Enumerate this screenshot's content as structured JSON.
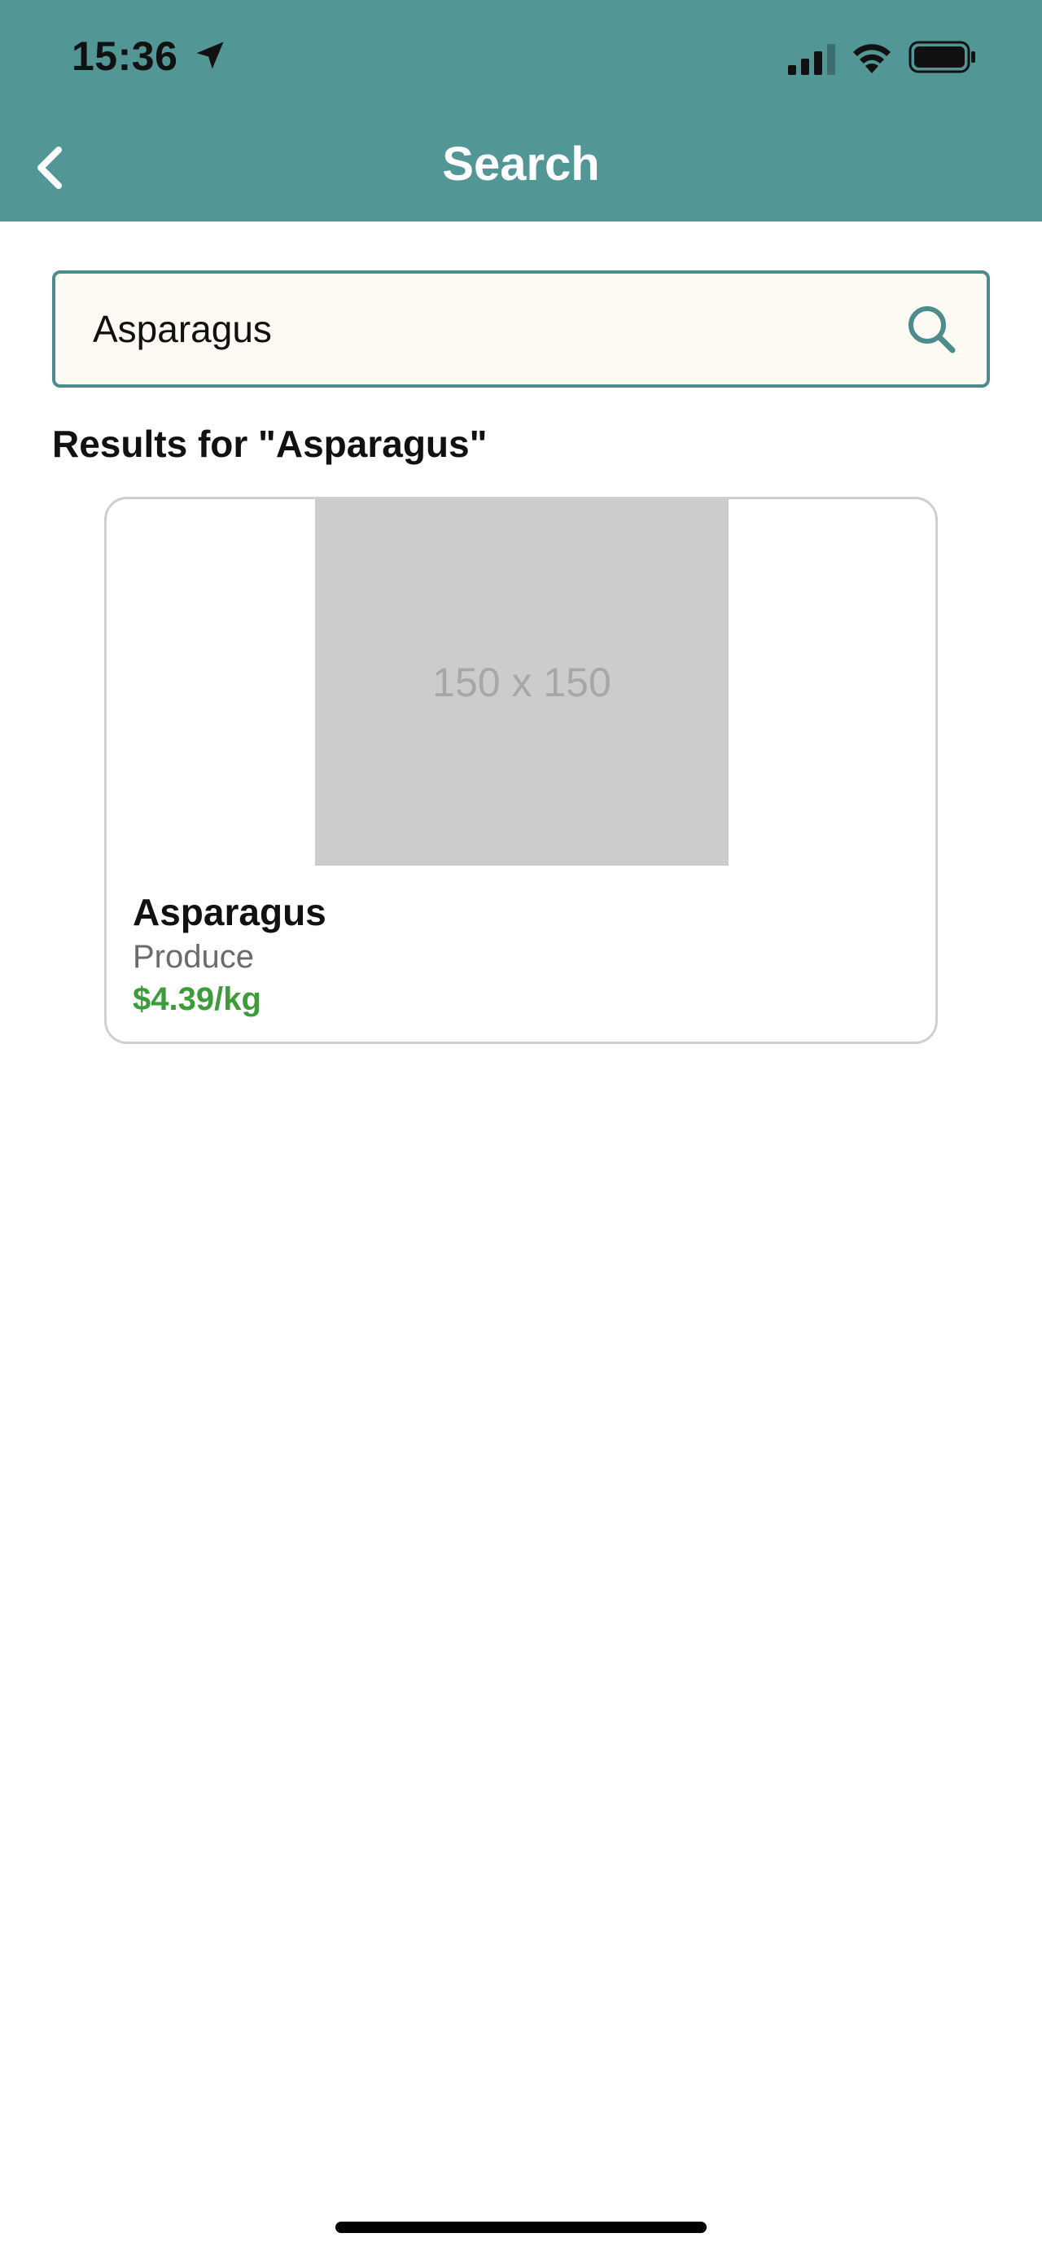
{
  "status_bar": {
    "time": "15:36",
    "icons": [
      "location-arrow-icon",
      "cellular-signal-icon",
      "wifi-icon",
      "battery-icon"
    ]
  },
  "nav": {
    "title": "Search",
    "back_icon": "chevron-left-icon"
  },
  "search": {
    "value": "Asparagus",
    "icon": "search-icon"
  },
  "results": {
    "heading": "Results for \"Asparagus\"",
    "items": [
      {
        "image_placeholder": "150 x 150",
        "name": "Asparagus",
        "category": "Produce",
        "price": "$4.39/kg"
      }
    ]
  },
  "colors": {
    "header_bg": "#529696",
    "accent": "#4c8c8c",
    "search_bg": "#fdfaf3",
    "price": "#3d9c3a"
  }
}
